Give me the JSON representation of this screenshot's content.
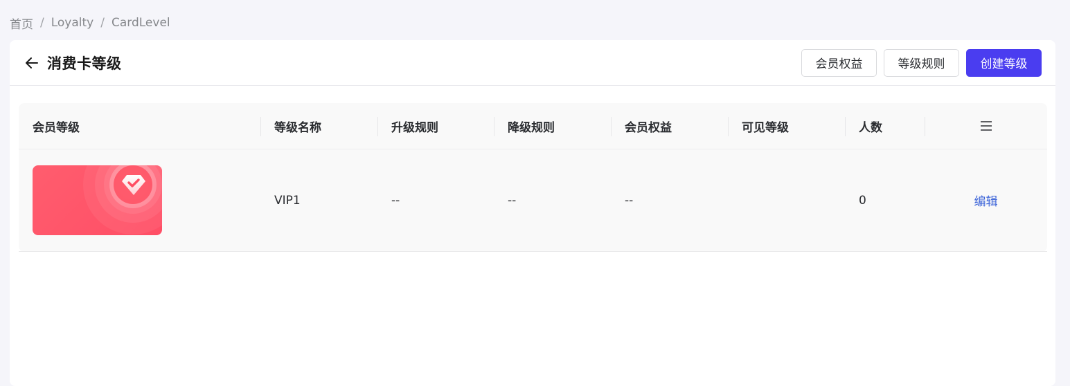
{
  "breadcrumb": {
    "items": [
      "首页",
      "Loyalty",
      "CardLevel"
    ],
    "separator": "/"
  },
  "header": {
    "back_icon": "arrow-left-icon",
    "title": "消费卡等级",
    "buttons": {
      "benefits_label": "会员权益",
      "rules_label": "等级规则",
      "create_label": "创建等级"
    },
    "primary_color": "#4a3df0"
  },
  "table": {
    "columns": [
      "会员等级",
      "等级名称",
      "升级规则",
      "降级规则",
      "会员权益",
      "可见等级",
      "人数"
    ],
    "menu_icon": "menu-lines-icon",
    "rows": [
      {
        "card_icon": "diamond-check-icon",
        "card_color": "#ff5466",
        "name": "VIP1",
        "upgrade_rule": "--",
        "downgrade_rule": "--",
        "benefits": "--",
        "visible_level": "",
        "count": "0",
        "action_label": "编辑"
      }
    ]
  }
}
